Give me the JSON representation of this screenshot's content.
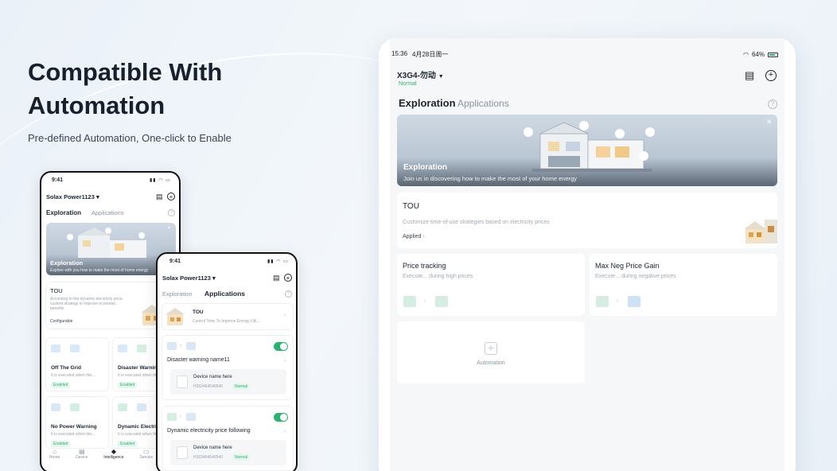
{
  "hero": {
    "title": "Compatible With\nAutomation",
    "subtitle": "Pre-defined Automation, One-click to Enable"
  },
  "tablet": {
    "status": {
      "time": "15:36",
      "date": "4月28日周一",
      "battery": "64%"
    },
    "device": {
      "name": "X3G4-勿动",
      "status": "Normal"
    },
    "tabs": [
      {
        "label": "Exploration",
        "active": true
      },
      {
        "label": "Applications",
        "active": false
      }
    ],
    "banner": {
      "title": "Exploration",
      "subtitle": "Join us in discovering how to make the most of your home energy"
    },
    "tou": {
      "title": "TOU",
      "desc": "Customize time-of-use strategies based on electricity prices",
      "status": "Applied"
    },
    "price_tracking": {
      "title": "Price tracking",
      "desc": "Execute... during high prices"
    },
    "max_neg": {
      "title": "Max Neg Price Gain",
      "desc": "Execute... during negative prices"
    },
    "automation": {
      "label": "Automation"
    }
  },
  "phone1": {
    "time": "9:41",
    "device": "Solax Power1123",
    "tabs": [
      {
        "label": "Exploration",
        "active": true
      },
      {
        "label": "Applications",
        "active": false
      }
    ],
    "banner": {
      "title": "Exploration",
      "subtitle": "Explore with you how to make the most of home energy"
    },
    "tou": {
      "title": "TOU",
      "desc": "According to the dynamic electricity price, custom strategy to improve economic benefits",
      "action": "Configurable"
    },
    "cards": [
      {
        "title": "Off The Grid",
        "desc": "It is executed when the...",
        "badge": "Enabled"
      },
      {
        "title": "Disaster Warning",
        "desc": "It is executed when the...",
        "badge": "Enabled"
      },
      {
        "title": "No Power Warning",
        "desc": "It is executed when the...",
        "badge": "Enabled"
      },
      {
        "title": "Dynamic Electric",
        "desc": "It is executed when the...",
        "badge": "Enabled"
      }
    ],
    "nav": [
      "Home",
      "Device",
      "Intelligence",
      "Service"
    ]
  },
  "phone2": {
    "time": "9:41",
    "device": "Solax Power1123",
    "tabs": [
      {
        "label": "Exploration",
        "active": false
      },
      {
        "label": "Applications",
        "active": true
      }
    ],
    "tou": {
      "title": "TOU",
      "desc": "Control Time To Improve Energy Util..."
    },
    "items": [
      {
        "title": "Disaster warning name11",
        "device": "Device name here",
        "sn": "H303464549540",
        "badge": "Normal"
      },
      {
        "title": "Dynamic electricity price following",
        "device": "Device name here",
        "sn": "H303464549540",
        "badge": "Normal"
      }
    ]
  },
  "colors": {
    "accent": "#2bb36e",
    "text": "#1c2430",
    "muted": "#8a94a0"
  }
}
